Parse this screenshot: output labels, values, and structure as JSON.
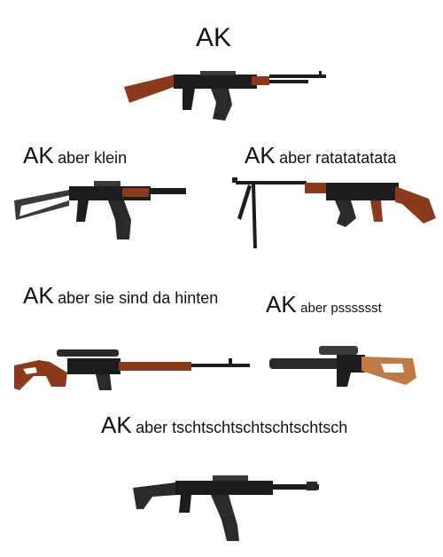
{
  "meme": {
    "title": "AK",
    "captions": [
      {
        "prefix": "AK",
        "suffix": "aber klein"
      },
      {
        "prefix": "AK",
        "suffix": "aber ratatatatata"
      },
      {
        "prefix": "AK",
        "suffix": "aber sie sind da hinten"
      },
      {
        "prefix": "AK",
        "suffix": "aber psssssst"
      },
      {
        "prefix": "AK",
        "suffix": "aber tschtschtschtschtschtsch"
      }
    ]
  },
  "colors": {
    "wood": "#8b3a1c",
    "wood_light": "#c07a45",
    "metal": "#1c1c1e",
    "metal_mid": "#3a3a3c",
    "background": "#ffffff"
  }
}
